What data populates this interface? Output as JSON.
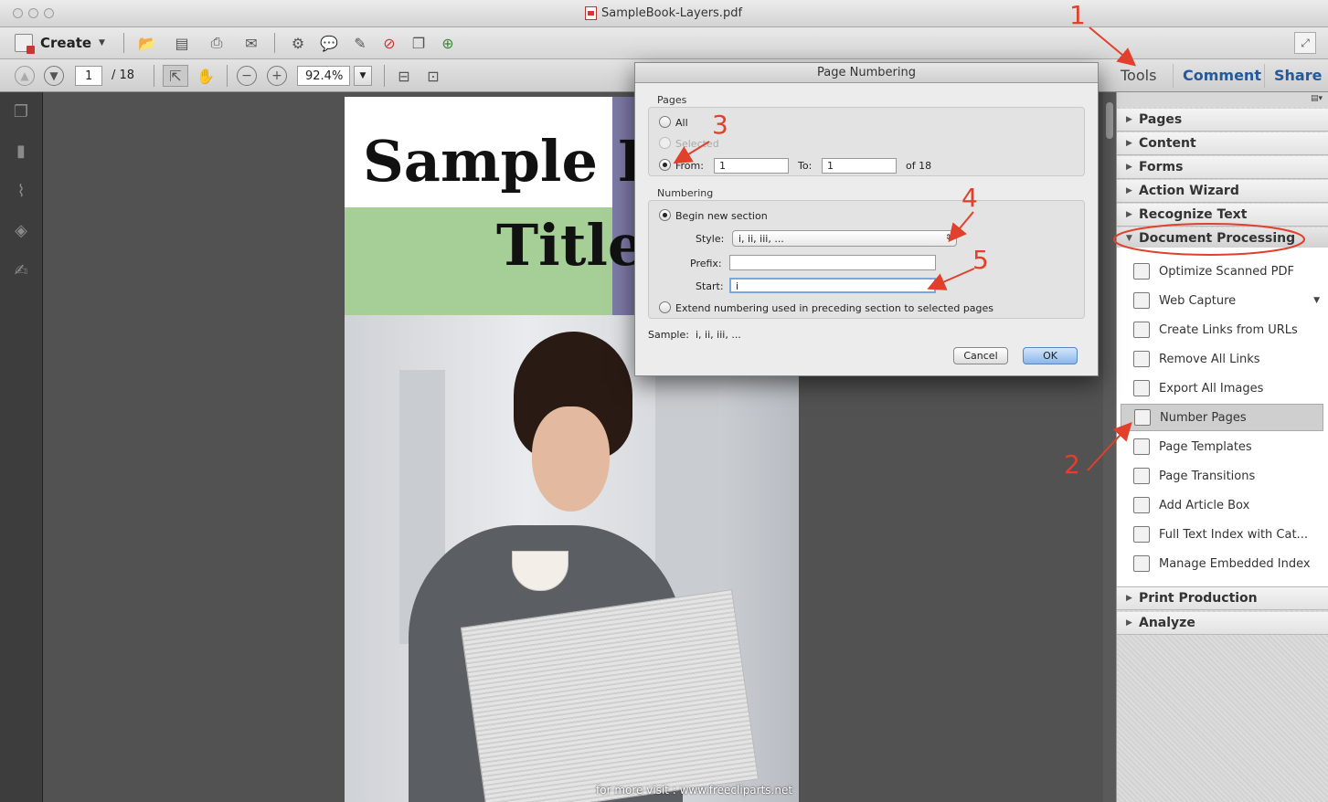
{
  "window": {
    "title": "SampleBook-Layers.pdf"
  },
  "toolbar": {
    "create_label": "Create",
    "page_current": "1",
    "page_total": "/ 18",
    "zoom": "92.4%"
  },
  "tabs": {
    "tools": "Tools",
    "comment": "Comment",
    "share": "Share"
  },
  "document": {
    "title_line1": "Sample I",
    "title_line2": "Title",
    "watermark": "for more visit : www.freecliparts.net"
  },
  "panel": {
    "sections_top": [
      "Pages",
      "Content",
      "Forms",
      "Action Wizard",
      "Recognize Text"
    ],
    "open_section": "Document Processing",
    "tools": [
      "Optimize Scanned PDF",
      "Web Capture",
      "Create Links from URLs",
      "Remove All Links",
      "Export All Images",
      "Number Pages",
      "Page Templates",
      "Page Transitions",
      "Add Article Box",
      "Full Text Index with Cat...",
      "Manage Embedded Index"
    ],
    "sections_bottom": [
      "Print Production",
      "Analyze"
    ]
  },
  "dialog": {
    "title": "Page Numbering",
    "pages_group": "Pages",
    "all": "All",
    "selected": "Selected",
    "from": "From:",
    "from_value": "1",
    "to": "To:",
    "to_value": "1",
    "of_total": "of 18",
    "numbering_group": "Numbering",
    "begin_new": "Begin new section",
    "style_label": "Style:",
    "style_value": "i, ii, iii, ...",
    "prefix_label": "Prefix:",
    "prefix_value": "",
    "start_label": "Start:",
    "start_value": "i",
    "extend": "Extend numbering used in preceding section to selected pages",
    "sample_label": "Sample:",
    "sample_value": "i, ii, iii, ...",
    "cancel": "Cancel",
    "ok": "OK"
  },
  "annotations": [
    "1",
    "2",
    "3",
    "4",
    "5"
  ],
  "colors": {
    "accent_blue": "#245a9c",
    "annotation_red": "#e0402c"
  }
}
